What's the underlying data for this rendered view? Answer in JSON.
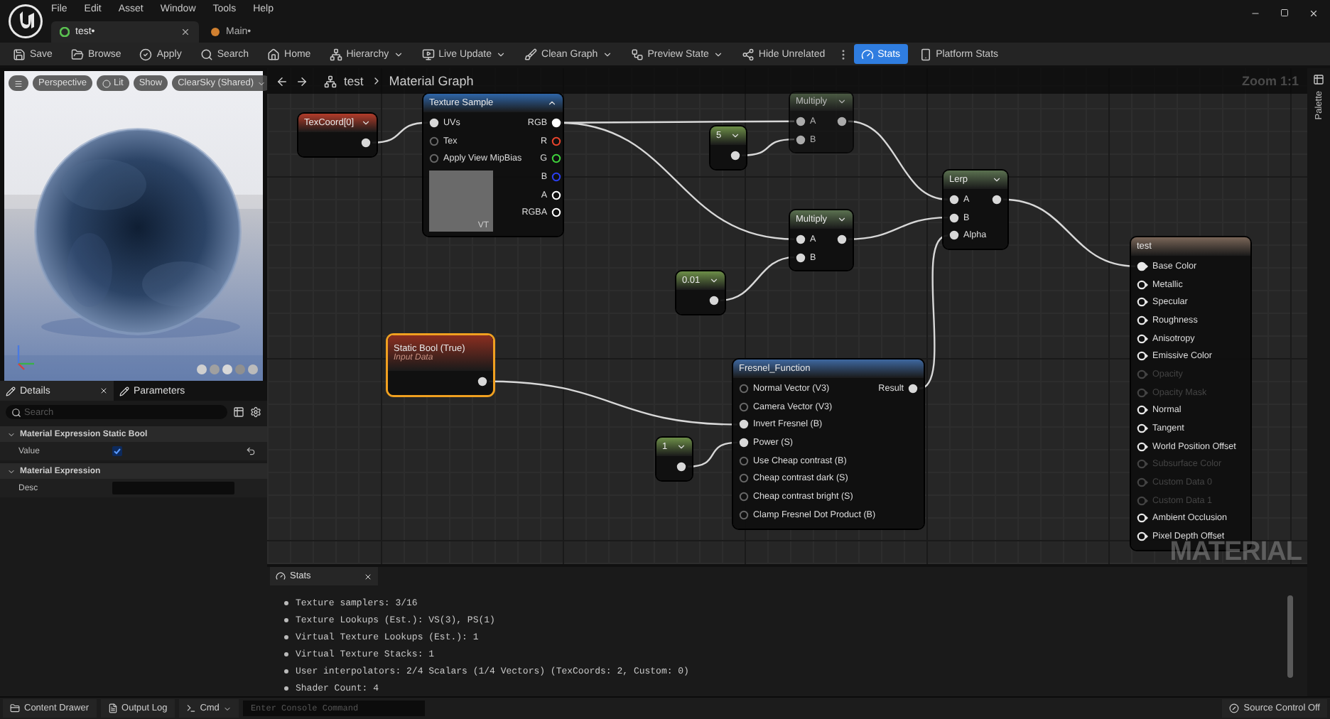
{
  "app": {
    "menu": [
      "File",
      "Edit",
      "Asset",
      "Window",
      "Tools",
      "Help"
    ],
    "doc_tabs": [
      {
        "label": "test•",
        "selected": true
      },
      {
        "label": "Main•",
        "selected": false
      }
    ]
  },
  "toolbar": [
    {
      "label": "Save",
      "dropdown": false,
      "selected": false
    },
    {
      "label": "Browse",
      "dropdown": false,
      "selected": false
    },
    {
      "label": "Apply",
      "dropdown": false,
      "selected": false
    },
    {
      "label": "Search",
      "dropdown": false,
      "selected": false
    },
    {
      "label": "Home",
      "dropdown": false,
      "selected": false
    },
    {
      "label": "Hierarchy",
      "dropdown": true,
      "selected": false
    },
    {
      "label": "Live Update",
      "dropdown": true,
      "selected": false
    },
    {
      "label": "Clean Graph",
      "dropdown": true,
      "selected": false
    },
    {
      "label": "Preview State",
      "dropdown": true,
      "selected": false
    },
    {
      "label": "Hide Unrelated",
      "dropdown": false,
      "selected": false
    },
    {
      "label": "Stats",
      "dropdown": false,
      "selected": true
    },
    {
      "label": "Platform Stats",
      "dropdown": false,
      "selected": false
    }
  ],
  "viewport": {
    "buttons": [
      {
        "label": "Perspective",
        "dropdown": false
      },
      {
        "label": "Lit",
        "dropdown": false
      },
      {
        "label": "Show",
        "dropdown": false
      },
      {
        "label": "ClearSky (Shared)",
        "dropdown": true
      }
    ]
  },
  "details": {
    "tabs": [
      {
        "label": "Details",
        "selected": true
      },
      {
        "label": "Parameters",
        "selected": false
      }
    ],
    "search_placeholder": "Search",
    "sections": [
      {
        "title": "Material Expression Static Bool",
        "expanded": true,
        "rows": [
          {
            "label": "Value",
            "kind": "checkbox",
            "checked": true
          }
        ]
      },
      {
        "title": "Material Expression",
        "expanded": true,
        "rows": [
          {
            "label": "Desc",
            "kind": "text"
          }
        ]
      }
    ]
  },
  "graph": {
    "breadcrumb": [
      "test",
      "Material Graph"
    ],
    "zoom": "Zoom 1:1",
    "graph_type": "MATERIAL",
    "palette": "Palette",
    "nodes": [
      {
        "kind": "coord",
        "title": "TexCoord[0]",
        "faded": false,
        "selected": false,
        "outputs": [
          {
            "connected": true
          }
        ]
      },
      {
        "kind": "texture",
        "title": "Texture Sample",
        "faded": false,
        "selected": false,
        "badge": "VT",
        "inputs": [
          {
            "label": "UVs",
            "connected": true
          },
          {
            "label": "Tex",
            "connected": false
          },
          {
            "label": "Apply View MipBias",
            "connected": false
          }
        ],
        "outputs": [
          {
            "label": "RGB",
            "connected": true,
            "color": "#ffffff"
          },
          {
            "label": "R",
            "connected": false,
            "color": "#e8442c"
          },
          {
            "label": "G",
            "connected": false,
            "color": "#3fd23c"
          },
          {
            "label": "B",
            "connected": false,
            "color": "#2b3ff0"
          },
          {
            "label": "A",
            "connected": false,
            "color": "#ffffff"
          },
          {
            "label": "RGBA",
            "connected": false,
            "color": "#ffffff"
          }
        ]
      },
      {
        "kind": "constant",
        "title": "5",
        "faded": false,
        "selected": false,
        "outputs": [
          {
            "connected": true
          }
        ]
      },
      {
        "kind": "math",
        "title": "Multiply",
        "faded": true,
        "selected": false,
        "inputs": [
          {
            "label": "A",
            "connected": true
          },
          {
            "label": "B",
            "connected": true
          }
        ],
        "outputs": [
          {
            "connected": true
          }
        ]
      },
      {
        "kind": "math",
        "title": "Multiply",
        "faded": false,
        "selected": false,
        "inputs": [
          {
            "label": "A",
            "connected": true
          },
          {
            "label": "B",
            "connected": true
          }
        ],
        "outputs": [
          {
            "connected": true
          }
        ]
      },
      {
        "kind": "math",
        "title": "Lerp",
        "faded": false,
        "selected": false,
        "inputs": [
          {
            "label": "A",
            "connected": true
          },
          {
            "label": "B",
            "connected": true
          },
          {
            "label": "Alpha",
            "connected": true
          }
        ],
        "outputs": [
          {
            "connected": true
          }
        ]
      },
      {
        "kind": "constant",
        "title": "0.01",
        "faded": false,
        "selected": false,
        "outputs": [
          {
            "connected": true
          }
        ]
      },
      {
        "kind": "result",
        "title": "test",
        "faded": false,
        "selected": false,
        "inputs": [
          {
            "label": "Base Color",
            "connected": true,
            "enabled": true
          },
          {
            "label": "Metallic",
            "connected": false,
            "enabled": true
          },
          {
            "label": "Specular",
            "connected": false,
            "enabled": true
          },
          {
            "label": "Roughness",
            "connected": false,
            "enabled": true
          },
          {
            "label": "Anisotropy",
            "connected": false,
            "enabled": true
          },
          {
            "label": "Emissive Color",
            "connected": false,
            "enabled": true
          },
          {
            "label": "Opacity",
            "connected": false,
            "enabled": false
          },
          {
            "label": "Opacity Mask",
            "connected": false,
            "enabled": false
          },
          {
            "label": "Normal",
            "connected": false,
            "enabled": true
          },
          {
            "label": "Tangent",
            "connected": false,
            "enabled": true
          },
          {
            "label": "World Position Offset",
            "connected": false,
            "enabled": true
          },
          {
            "label": "Subsurface Color",
            "connected": false,
            "enabled": false
          },
          {
            "label": "Custom Data 0",
            "connected": false,
            "enabled": false
          },
          {
            "label": "Custom Data 1",
            "connected": false,
            "enabled": false
          },
          {
            "label": "Ambient Occlusion",
            "connected": false,
            "enabled": true
          },
          {
            "label": "Pixel Depth Offset",
            "connected": false,
            "enabled": true
          }
        ]
      },
      {
        "kind": "bool",
        "title": "Static Bool (True)",
        "subtitle": "Input Data",
        "faded": false,
        "selected": true,
        "outputs": [
          {
            "connected": true
          }
        ]
      },
      {
        "kind": "constant",
        "title": "1",
        "faded": false,
        "selected": false,
        "outputs": [
          {
            "connected": true
          }
        ]
      },
      {
        "kind": "function",
        "title": "Fresnel_Function",
        "faded": false,
        "selected": false,
        "inputs": [
          {
            "label": "Normal Vector (V3)",
            "connected": false
          },
          {
            "label": "Camera Vector (V3)",
            "connected": false
          },
          {
            "label": "Invert Fresnel (B)",
            "connected": true
          },
          {
            "label": "Power (S)",
            "connected": true
          },
          {
            "label": "Use Cheap contrast (B)",
            "connected": false
          },
          {
            "label": "Cheap contrast dark (S)",
            "connected": false
          },
          {
            "label": "Cheap contrast bright (S)",
            "connected": false
          },
          {
            "label": "Clamp Fresnel Dot Product (B)",
            "connected": false
          }
        ],
        "outputs": [
          {
            "label": "Result",
            "connected": true
          }
        ]
      }
    ]
  },
  "stats": {
    "tab": "Stats",
    "lines": [
      "Texture samplers: 3/16",
      "Texture Lookups (Est.): VS(3), PS(1)",
      "Virtual Texture Lookups (Est.): 1",
      "Virtual Texture Stacks: 1",
      "User interpolators: 2/4 Scalars (1/4 Vectors) (TexCoords: 2, Custom: 0)",
      "Shader Count: 4"
    ]
  },
  "status_bar": {
    "content_drawer": "Content Drawer",
    "output_log": "Output Log",
    "cmd": "Cmd",
    "console_placeholder": "Enter Console Command",
    "source_control": "Source Control Off"
  }
}
